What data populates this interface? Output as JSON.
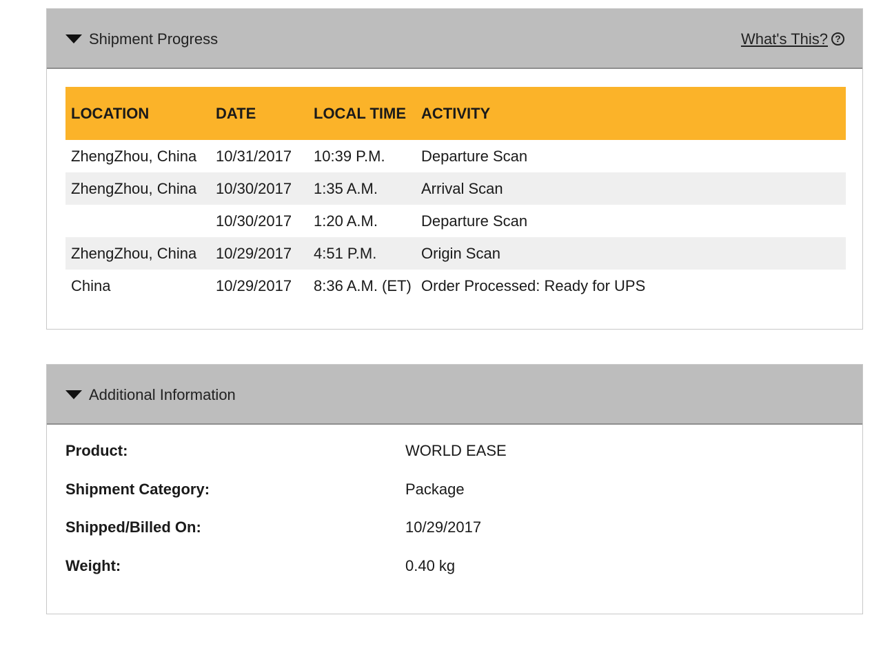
{
  "shipment_progress": {
    "title": "Shipment Progress",
    "help_link": "What's This?",
    "help_icon": "help-circle-icon",
    "columns": [
      "LOCATION",
      "DATE",
      "LOCAL TIME",
      "ACTIVITY"
    ],
    "rows": [
      {
        "location": "ZhengZhou, China",
        "date": "10/31/2017",
        "time": "10:39 P.M.",
        "activity": "Departure Scan"
      },
      {
        "location": "ZhengZhou, China",
        "date": "10/30/2017",
        "time": "1:35 A.M.",
        "activity": "Arrival Scan"
      },
      {
        "location": "",
        "date": "10/30/2017",
        "time": "1:20 A.M.",
        "activity": "Departure Scan"
      },
      {
        "location": "ZhengZhou, China",
        "date": "10/29/2017",
        "time": "4:51 P.M.",
        "activity": "Origin Scan"
      },
      {
        "location": "China",
        "date": "10/29/2017",
        "time": "8:36 A.M. (ET)",
        "activity": "Order Processed: Ready for UPS"
      }
    ]
  },
  "additional_information": {
    "title": "Additional Information",
    "fields": [
      {
        "label": "Product:",
        "value": "WORLD EASE"
      },
      {
        "label": "Shipment Category:",
        "value": "Package"
      },
      {
        "label": "Shipped/Billed On:",
        "value": "10/29/2017"
      },
      {
        "label": "Weight:",
        "value": "0.40 kg"
      }
    ]
  },
  "colors": {
    "header_bg": "#bdbdbd",
    "table_header_bg": "#fbb329",
    "alt_row_bg": "#efefef",
    "border": "#c8c8c8"
  }
}
